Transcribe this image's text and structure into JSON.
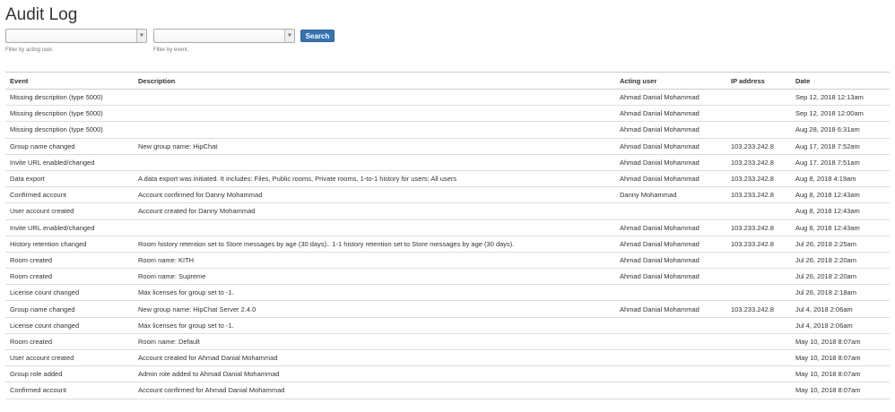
{
  "page": {
    "title": "Audit Log"
  },
  "filters": {
    "user_value": "",
    "user_hint": "Filter by acting user.",
    "event_value": "",
    "event_hint": "Filter by event.",
    "search_label": "Search"
  },
  "table": {
    "headers": {
      "event": "Event",
      "description": "Description",
      "user": "Acting user",
      "ip": "IP address",
      "date": "Date"
    },
    "rows": [
      {
        "event": "Missing description (type 5000)",
        "description": "",
        "user": "Ahmad Danial Mohammad",
        "ip": "",
        "date": "Sep 12, 2018 12:13am"
      },
      {
        "event": "Missing description (type 5000)",
        "description": "",
        "user": "Ahmad Danial Mohammad",
        "ip": "",
        "date": "Sep 12, 2018 12:00am"
      },
      {
        "event": "Missing description (type 5000)",
        "description": "",
        "user": "Ahmad Danial Mohammad",
        "ip": "",
        "date": "Aug 28, 2018 6:31am"
      },
      {
        "event": "Group name changed",
        "description": "New group name: HipChat",
        "user": "Ahmad Danial Mohammad",
        "ip": "103.233.242.8",
        "date": "Aug 17, 2018 7:52am"
      },
      {
        "event": "Invite URL enabled/changed",
        "description": "",
        "user": "Ahmad Danial Mohammad",
        "ip": "103.233.242.8",
        "date": "Aug 17, 2018 7:51am"
      },
      {
        "event": "Data export",
        "description": "A data export was initiated. It includes: Files, Public rooms, Private rooms, 1-to-1 history for users: All users",
        "user": "Ahmad Danial Mohammad",
        "ip": "103.233.242.8",
        "date": "Aug 8, 2018 4:19am"
      },
      {
        "event": "Confirmed account",
        "description": "Account confirmed for Danny Mohammad",
        "user": "Danny Mohammad",
        "ip": "103.233.242.8",
        "date": "Aug 8, 2018 12:43am"
      },
      {
        "event": "User account created",
        "description": "Account created for Danny Mohammad",
        "user": "",
        "ip": "",
        "date": "Aug 8, 2018 12:43am"
      },
      {
        "event": "Invite URL enabled/changed",
        "description": "",
        "user": "Ahmad Danial Mohammad",
        "ip": "103.233.242.8",
        "date": "Aug 8, 2018 12:43am"
      },
      {
        "event": "History retention changed",
        "description": "Room history retention set to Store messages by age (30 days).. 1-1 history retention set to Store messages by age (30 days).",
        "user": "Ahmad Danial Mohammad",
        "ip": "103.233.242.8",
        "date": "Jul 26, 2018 2:25am"
      },
      {
        "event": "Room created",
        "description": "Room name: KITH",
        "user": "Ahmad Danial Mohammad",
        "ip": "",
        "date": "Jul 26, 2018 2:20am"
      },
      {
        "event": "Room created",
        "description": "Room name: Supreme",
        "user": "Ahmad Danial Mohammad",
        "ip": "",
        "date": "Jul 26, 2018 2:20am"
      },
      {
        "event": "License count changed",
        "description": "Max licenses for group set to -1.",
        "user": "",
        "ip": "",
        "date": "Jul 26, 2018 2:18am"
      },
      {
        "event": "Group name changed",
        "description": "New group name: HipChat Server 2.4.0",
        "user": "Ahmad Danial Mohammad",
        "ip": "103.233.242.8",
        "date": "Jul 4, 2018 2:06am"
      },
      {
        "event": "License count changed",
        "description": "Max licenses for group set to -1.",
        "user": "",
        "ip": "",
        "date": "Jul 4, 2018 2:06am"
      },
      {
        "event": "Room created",
        "description": "Room name: Default",
        "user": "",
        "ip": "",
        "date": "May 10, 2018 8:07am"
      },
      {
        "event": "User account created",
        "description": "Account created for Ahmad Danial Mohammad",
        "user": "",
        "ip": "",
        "date": "May 10, 2018 8:07am"
      },
      {
        "event": "Group role added",
        "description": "Admin role added to Ahmad Danial Mohammad",
        "user": "",
        "ip": "",
        "date": "May 10, 2018 8:07am"
      },
      {
        "event": "Confirmed account",
        "description": "Account confirmed for Ahmad Danial Mohammad",
        "user": "",
        "ip": "",
        "date": "May 10, 2018 8:07am"
      }
    ]
  }
}
